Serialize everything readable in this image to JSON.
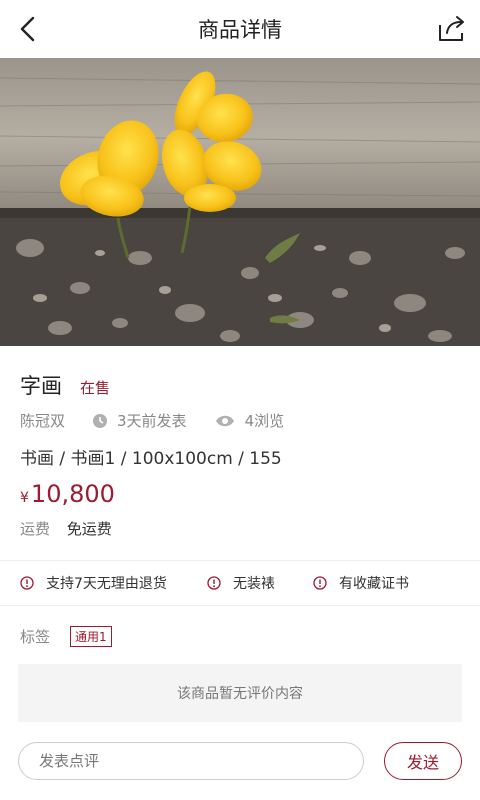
{
  "header": {
    "title": "商品详情"
  },
  "product": {
    "name": "字画",
    "status": "在售",
    "author": "陈冠双",
    "posted": "3天前发表",
    "views": "4浏览",
    "spec": "书画 / 书画1 / 100x100cm / 155",
    "currency": "¥",
    "price": "10,800",
    "shipping_label": "运费",
    "shipping_value": "免运费"
  },
  "guarantees": [
    "支持7天无理由退货",
    "无装裱",
    "有收藏证书"
  ],
  "tags": {
    "label": "标签",
    "items": [
      "通用1"
    ]
  },
  "comments": {
    "empty_text": "该商品暂无评价内容"
  },
  "comment_bar": {
    "placeholder": "发表点评",
    "send_label": "发送"
  },
  "colors": {
    "accent": "#9b1b30",
    "muted": "#888888"
  },
  "icons": {
    "back": "chevron-left-icon",
    "share": "share-icon",
    "time": "clock-icon",
    "views": "eye-icon",
    "info": "info-circle-icon"
  }
}
